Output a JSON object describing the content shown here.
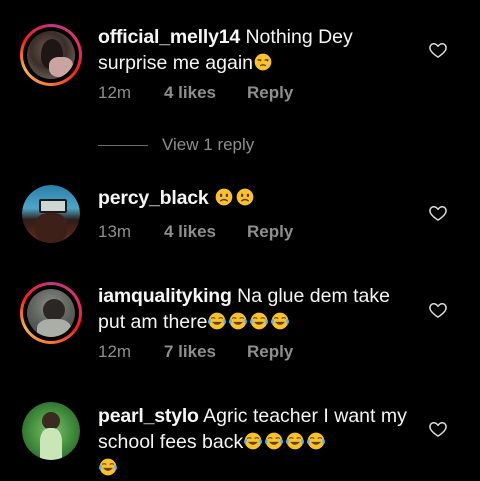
{
  "comments": [
    {
      "username": "official_melly14",
      "text": "Nothing Dey surprise me again",
      "time": "12m",
      "likes": "4 likes",
      "reply": "Reply",
      "emojis": [
        "unamused-face"
      ]
    },
    {
      "username": "percy_black",
      "text": "",
      "time": "13m",
      "likes": "4 likes",
      "reply": "Reply",
      "emojis": [
        "frowning-face",
        "frowning-face"
      ]
    },
    {
      "username": "iamqualityking",
      "text": "Na glue dem take put am there",
      "time": "12m",
      "likes": "7 likes",
      "reply": "Reply",
      "emojis": [
        "tears-of-joy",
        "tears-of-joy",
        "tears-of-joy",
        "tears-of-joy"
      ]
    },
    {
      "username": "pearl_stylo",
      "text": "Agric teacher I want my school fees back",
      "time": "",
      "likes": "",
      "reply": "",
      "emojis": [
        "tears-of-joy",
        "tears-of-joy",
        "tears-of-joy",
        "tears-of-joy",
        "tears-of-joy"
      ]
    }
  ],
  "view_replies": "View 1 reply",
  "icons": {
    "like": "heart-outline-icon"
  },
  "colors": {
    "meta": "#8e8e8e",
    "background": "#000000"
  }
}
